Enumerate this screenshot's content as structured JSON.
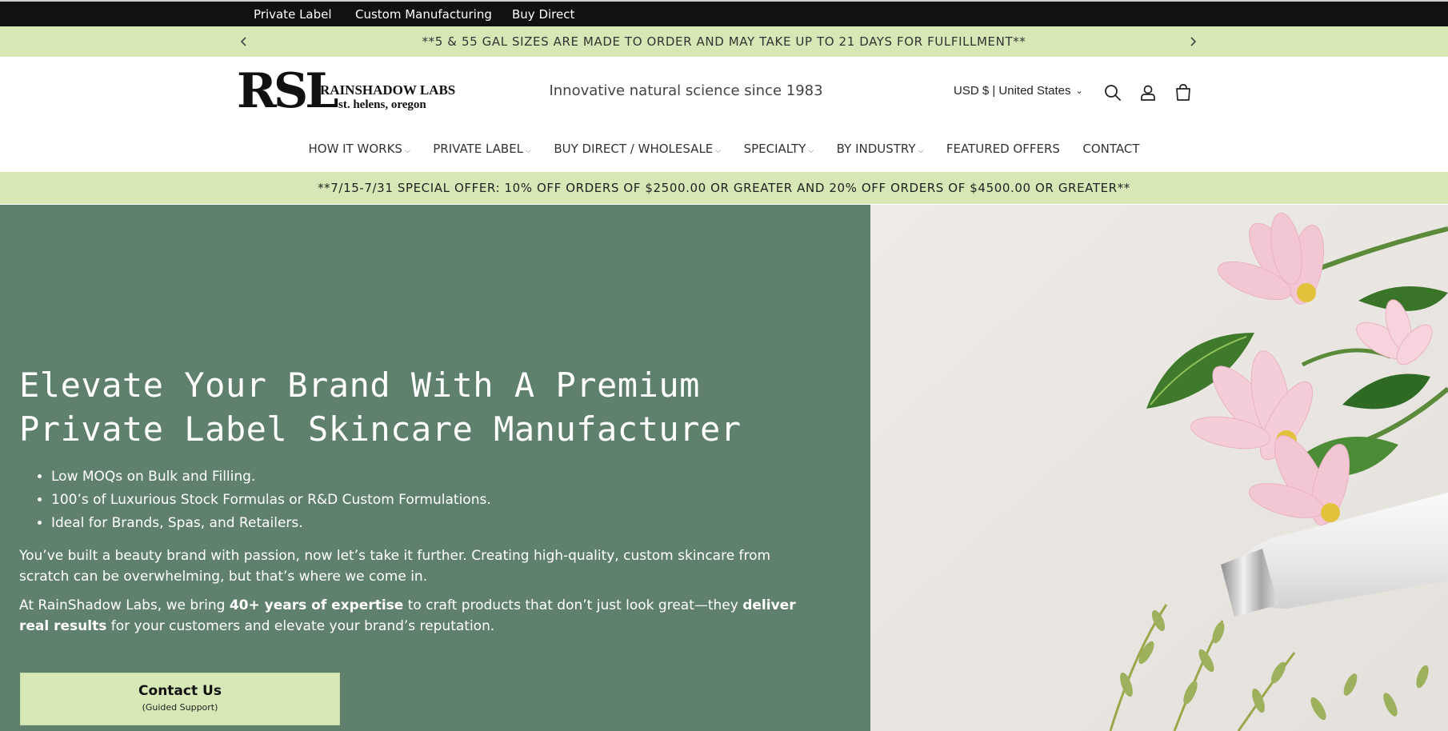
{
  "utility_nav": {
    "links": [
      "Private Label",
      "Custom Manufacturing",
      "Buy Direct"
    ]
  },
  "announcement": {
    "text": "**5 & 55 GAL SIZES ARE MADE TO ORDER AND MAY TAKE UP TO 21 DAYS FOR FULFILLMENT**",
    "prev_icon": "chevron-left-icon",
    "next_icon": "chevron-right-icon"
  },
  "header": {
    "logo": {
      "mark": "RSL",
      "name": "RAINSHADOW LABS",
      "location": "st. helens, oregon"
    },
    "tagline": "Innovative natural science since 1983",
    "currency": "USD $ | United States",
    "icons": [
      "search-icon",
      "account-icon",
      "cart-icon"
    ]
  },
  "main_nav": {
    "items": [
      {
        "label": "HOW IT WORKS",
        "has_dropdown": true
      },
      {
        "label": "PRIVATE LABEL",
        "has_dropdown": true
      },
      {
        "label": "BUY DIRECT / WHOLESALE",
        "has_dropdown": true
      },
      {
        "label": "SPECIALTY",
        "has_dropdown": true
      },
      {
        "label": "BY INDUSTRY",
        "has_dropdown": true
      },
      {
        "label": "FEATURED OFFERS",
        "has_dropdown": false
      },
      {
        "label": "CONTACT",
        "has_dropdown": false
      }
    ]
  },
  "offer_bar": {
    "text": "**7/15-7/31 SPECIAL OFFER: 10% OFF ORDERS OF $2500.00 OR GREATER AND 20% OFF ORDERS OF $4500.00 OR GREATER**"
  },
  "hero": {
    "title": "Elevate Your Brand With A Premium Private Label Skincare Manufacturer",
    "bullets": [
      "Low MOQs on Bulk and Filling.",
      "100’s of Luxurious Stock Formulas or R&D Custom Formulations.",
      "Ideal for Brands, Spas, and Retailers."
    ],
    "paragraph1": "You’ve built a beauty brand with passion, now let’s take it further. Creating high-quality, custom skincare from scratch can be overwhelming, but that’s where we come in.",
    "paragraph2": {
      "part1": "At RainShadow Labs, we bring ",
      "bold1": "40+ years of expertise",
      "part2": " to craft products that don’t just look great—they ",
      "bold2": "deliver real results",
      "part3": " for your customers and elevate your brand’s reputation."
    },
    "cta": {
      "label": "Contact Us",
      "sublabel": "(Guided Support)"
    }
  },
  "colors": {
    "utility_bar": "#111111",
    "accent_green": "#d6e8b6",
    "hero_green": "#5f806c",
    "flower_pink": "#f3c6d3"
  }
}
